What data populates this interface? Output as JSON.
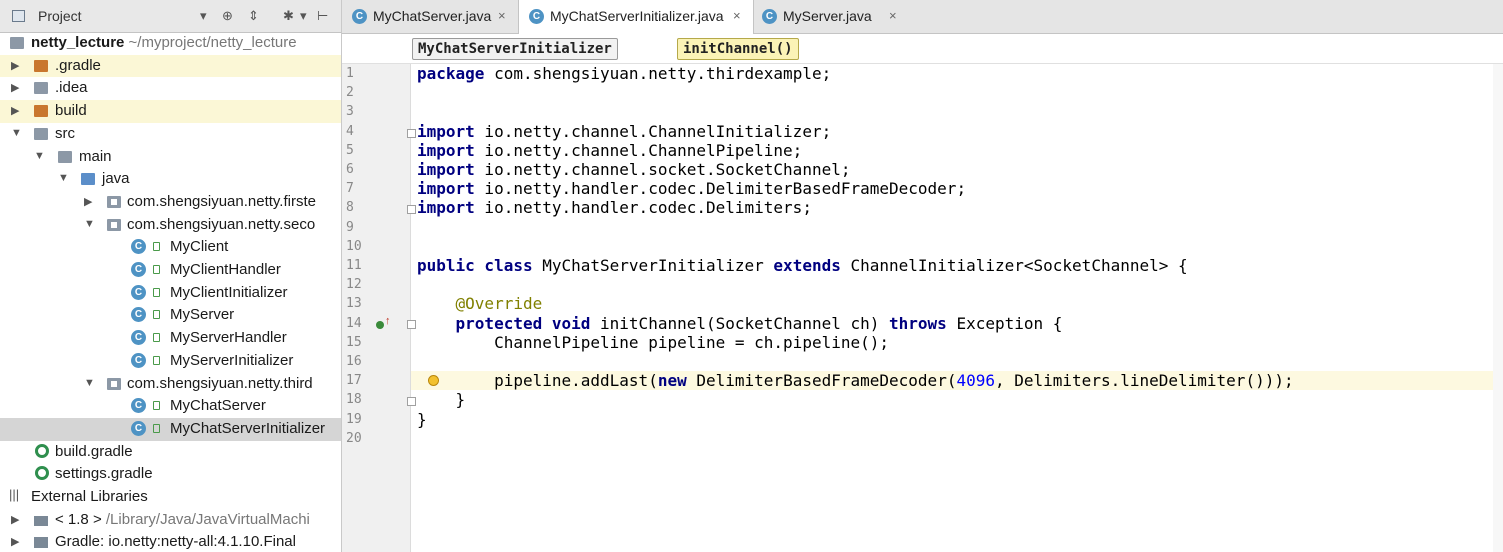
{
  "sidebar": {
    "title": "Project",
    "tree": [
      {
        "label": "netty_lecture",
        "path": " ~/myproject/netty_lecture"
      },
      {
        "label": ".gradle"
      },
      {
        "label": ".idea"
      },
      {
        "label": "build"
      },
      {
        "label": "src"
      },
      {
        "label": "main"
      },
      {
        "label": "java"
      },
      {
        "label": "com.shengsiyuan.netty.firste"
      },
      {
        "label": "com.shengsiyuan.netty.seco"
      },
      {
        "label": "MyClient"
      },
      {
        "label": "MyClientHandler"
      },
      {
        "label": "MyClientInitializer"
      },
      {
        "label": "MyServer"
      },
      {
        "label": "MyServerHandler"
      },
      {
        "label": "MyServerInitializer"
      },
      {
        "label": "com.shengsiyuan.netty.third"
      },
      {
        "label": "MyChatServer"
      },
      {
        "label": "MyChatServerInitializer"
      },
      {
        "label": "build.gradle"
      },
      {
        "label": "settings.gradle"
      },
      {
        "label": "External Libraries"
      },
      {
        "label": "< 1.8 >",
        "path": " /Library/Java/JavaVirtualMachi"
      },
      {
        "label": "Gradle: io.netty:netty-all:4.1.10.Final"
      }
    ]
  },
  "tabs": [
    {
      "label": "MyChatServer.java",
      "close": "×"
    },
    {
      "label": "MyChatServerInitializer.java",
      "close": "×"
    },
    {
      "label": "MyServer.java",
      "close": "×"
    }
  ],
  "breadcrumbs": [
    "MyChatServerInitializer",
    "initChannel()"
  ],
  "editor": {
    "lines": [
      "1",
      "2",
      "3",
      "4",
      "5",
      "6",
      "7",
      "8",
      "9",
      "10",
      "11",
      "12",
      "13",
      "14",
      "15",
      "16",
      "17",
      "18",
      "19",
      "20"
    ],
    "code": {
      "l1": {
        "kw": "package",
        "rest": " com.shengsiyuan.netty.thirdexample;"
      },
      "l4": {
        "kw": "import",
        "rest": " io.netty.channel.ChannelInitializer;"
      },
      "l5": {
        "kw": "import",
        "rest": " io.netty.channel.ChannelPipeline;"
      },
      "l6": {
        "kw": "import",
        "rest": " io.netty.channel.socket.SocketChannel;"
      },
      "l7": {
        "kw": "import",
        "rest": " io.netty.handler.codec.DelimiterBasedFrameDecoder;"
      },
      "l8": {
        "kw": "import",
        "rest": " io.netty.handler.codec.Delimiters;"
      },
      "l11": {
        "kw1": "public class",
        "mid": " MyChatServerInitializer ",
        "kw2": "extends",
        "rest": " ChannelInitializer<SocketChannel> {"
      },
      "l13": {
        "anno": "@Override"
      },
      "l14": {
        "kw1": "protected void",
        "mid": " initChannel(SocketChannel ch) ",
        "kw2": "throws",
        "rest": " Exception {"
      },
      "l15": {
        "text": "ChannelPipeline pipeline = ch.pipeline();"
      },
      "l17": {
        "pre": "pipeline.addLast(",
        "kw": "new",
        "mid": " DelimiterBasedFrameDecoder(",
        "num": "4096",
        "rest": ", Delimiters.lineDelimiter()));"
      },
      "l18": {
        "text": "}"
      },
      "l19": {
        "text": "}"
      }
    }
  },
  "colors": {
    "keyword": "#000080",
    "annotation": "#808000",
    "number": "#0000ff",
    "current_line": "#fdf9e0",
    "class_icon": "#4e93c4"
  }
}
